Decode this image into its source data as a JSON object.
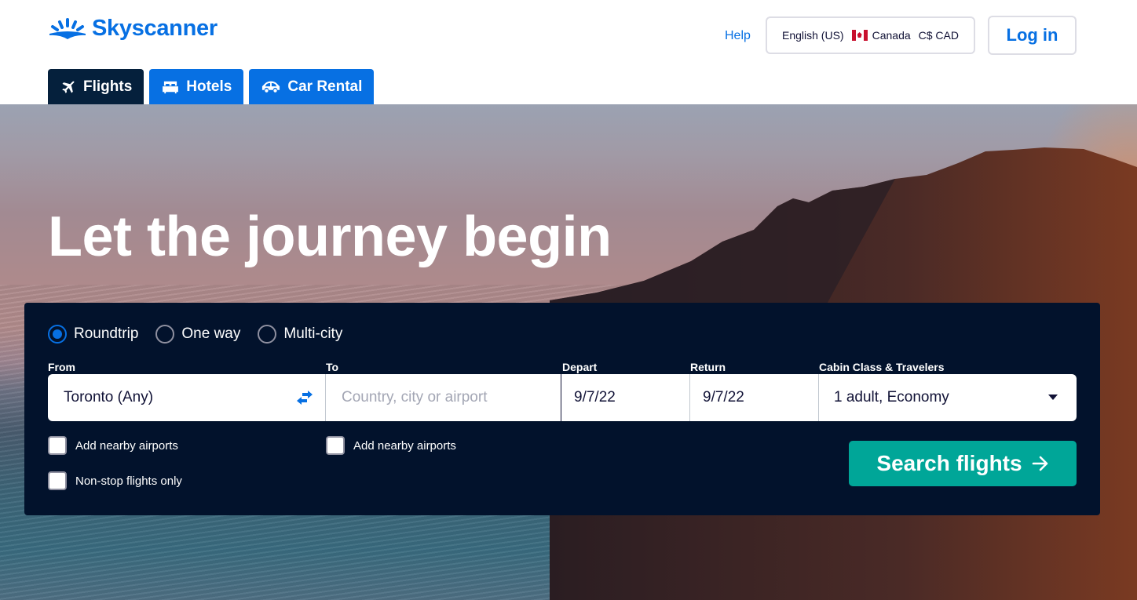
{
  "header": {
    "logo_text": "Skyscanner",
    "help_label": "Help",
    "locale": {
      "language": "English (US)",
      "country": "Canada",
      "currency": "C$ CAD"
    },
    "login_label": "Log in"
  },
  "tabs": [
    {
      "label": "Flights",
      "icon": "plane-icon",
      "active": true
    },
    {
      "label": "Hotels",
      "icon": "bed-icon",
      "active": false
    },
    {
      "label": "Car Rental",
      "icon": "car-icon",
      "active": false
    }
  ],
  "hero": {
    "title": "Let the journey begin"
  },
  "search": {
    "trip_types": [
      {
        "label": "Roundtrip",
        "checked": true
      },
      {
        "label": "One way",
        "checked": false
      },
      {
        "label": "Multi-city",
        "checked": false
      }
    ],
    "labels": {
      "from": "From",
      "to": "To",
      "depart": "Depart",
      "return": "Return",
      "cabin": "Cabin Class & Travelers"
    },
    "from_value": "Toronto (Any)",
    "to_value": "",
    "to_placeholder": "Country, city or airport",
    "depart_value": "9/7/22",
    "return_value": "9/7/22",
    "cabin_value": "1 adult, Economy",
    "checkboxes": {
      "from_nearby": "Add nearby airports",
      "to_nearby": "Add nearby airports",
      "nonstop": "Non-stop flights only"
    },
    "search_button": "Search flights",
    "colors": {
      "brand_blue": "#0770e3",
      "panel": "#02122c",
      "search_green": "#00a698"
    }
  }
}
